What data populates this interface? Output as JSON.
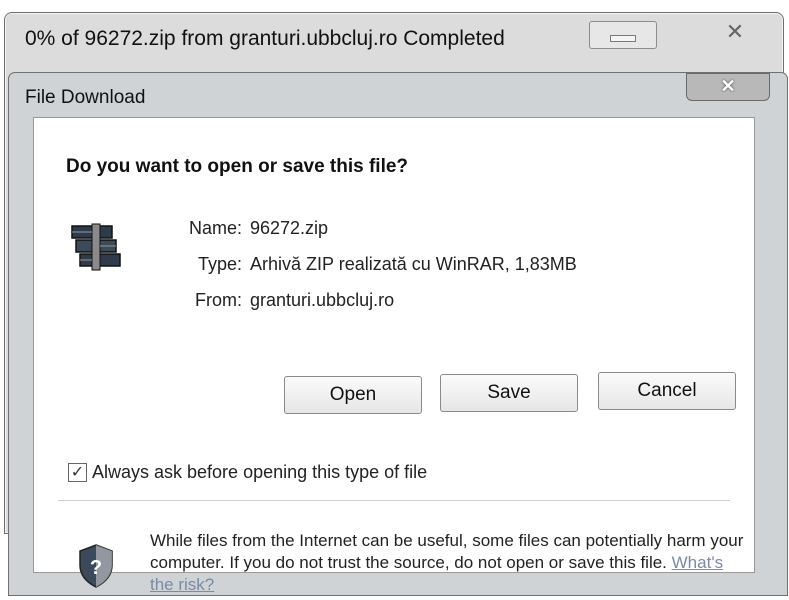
{
  "outer_window": {
    "title": "0% of 96272.zip from granturi.ubbcluj.ro Completed",
    "minimize_icon": "minimize-icon",
    "close_icon": "close-icon"
  },
  "dialog": {
    "title": "File Download",
    "close_icon": "close-icon",
    "question": "Do you want to open or save this file?",
    "file": {
      "icon": "winrar-archive-icon",
      "name_label": "Name:",
      "name_value": "96272.zip",
      "type_label": "Type:",
      "type_value": "Arhivă ZIP realizată cu WinRAR, 1,83MB",
      "from_label": "From:",
      "from_value": "granturi.ubbcluj.ro"
    },
    "buttons": {
      "open": "Open",
      "save": "Save",
      "cancel": "Cancel"
    },
    "checkbox": {
      "checked": true,
      "label": "Always ask before opening this type of file"
    },
    "warning": {
      "icon": "shield-question-icon",
      "text": "While files from the Internet can be useful, some files can potentially harm your computer. If you do not trust the source, do not open or save this file. ",
      "link": "What's the risk?"
    }
  }
}
